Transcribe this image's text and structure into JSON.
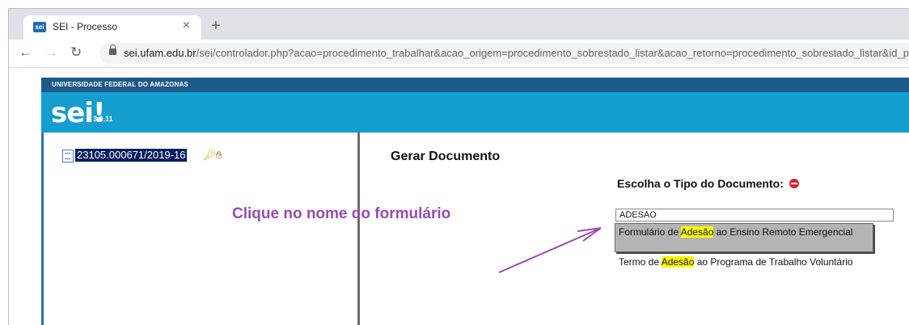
{
  "browser": {
    "tab_title": "SEI - Processo",
    "tab_favicon_text": "sei",
    "url_host": "sei.ufam.edu.br",
    "url_path": "/sei/controlador.php?acao=procedimento_trabalhar&acao_origem=procedimento_sobrestado_listar&acao_retorno=procedimento_sobrestado_listar&id_proced"
  },
  "header": {
    "org": "UNIVERSIDADE FEDERAL DO AMAZONAS",
    "logo": "sei!",
    "version": "3.0.11",
    "topbar_color": "#1e5a89",
    "brand_color": "#149ecf"
  },
  "tree": {
    "process_number": "23105.000671/2019-16"
  },
  "main": {
    "heading": "Gerar Documento",
    "subhead": "Escolha o Tipo do Documento:",
    "filter_value": "ADESAO",
    "options": [
      {
        "pre": "Formulário de ",
        "match": "Adesão",
        "post": " ao Ensino Remoto Emergencial"
      },
      {
        "pre": "Termo de ",
        "match": "Adesão",
        "post": " ao Programa de Trabalho Voluntário"
      }
    ]
  },
  "annotation": {
    "text": "Clique no nome do formulário",
    "color": "#9b4bb0"
  }
}
